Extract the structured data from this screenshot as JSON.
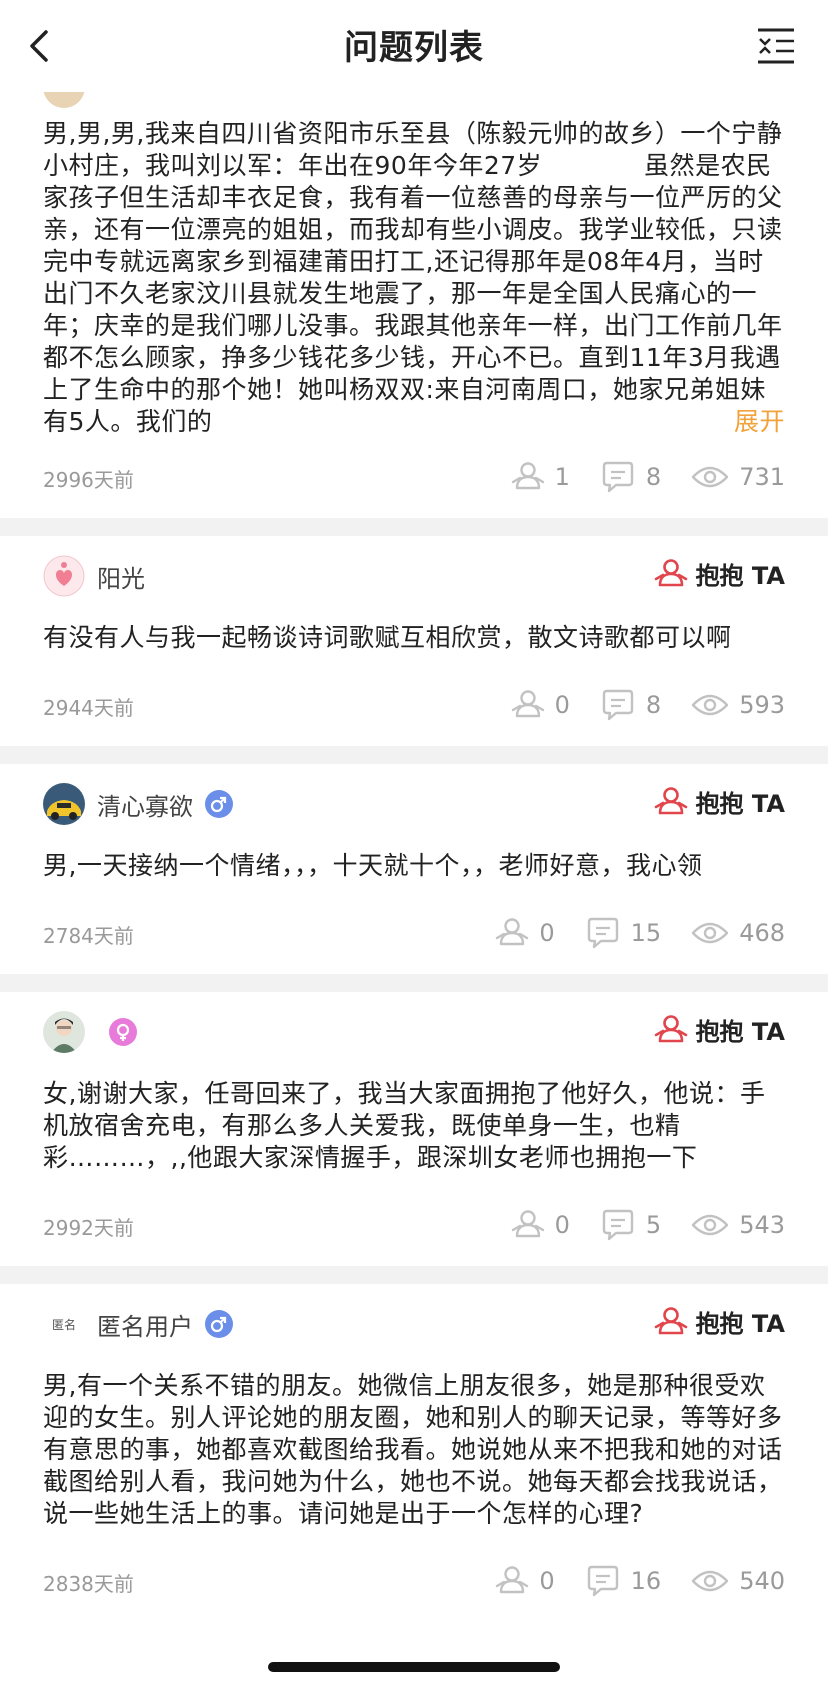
{
  "header": {
    "title": "问题列表"
  },
  "hug_label": "抱抱 TA",
  "expand_label": "展开",
  "posts": [
    {
      "body": "男,男,男,我来自四川省资阳市乐至县（陈毅元帅的故乡）一个宁静小村庄，我叫刘以军：年出在90年今年27岁　　　　虽然是农民家孩子但生活却丰衣足食，我有着一位慈善的母亲与一位严厉的父亲，还有一位漂亮的姐姐，而我却有些小调皮。我学业较低，只读完中专就远离家乡到福建莆田打工,还记得那年是08年4月，当时出门不久老家汶川县就发生地震了，那一年是全国人民痛心的一年；庆幸的是我们哪儿没事。我跟其他亲年一样，出门工作前几年都不怎么顾家，挣多少钱花多少钱，开心不已。直到11年3月我遇上了生命中的那个她！她叫杨双双:来自河南周口，她家兄弟姐妹有5人。我们的",
      "time": "2996天前",
      "hugs": "1",
      "comments": "8",
      "views": "731"
    },
    {
      "username": "阳光",
      "body": "有没有人与我一起畅谈诗词歌赋互相欣赏，散文诗歌都可以啊",
      "time": "2944天前",
      "hugs": "0",
      "comments": "8",
      "views": "593"
    },
    {
      "username": "清心寡欲",
      "body": "男,一天接纳一个情绪，，，十天就十个，，老师好意，我心领",
      "time": "2784天前",
      "hugs": "0",
      "comments": "15",
      "views": "468"
    },
    {
      "username": "",
      "body": "女,谢谢大家，任哥回来了，我当大家面拥抱了他好久，他说：手机放宿舍充电，有那么多人关爱我，既使单身一生，也精彩………，,,他跟大家深情握手，跟深圳女老师也拥抱一下",
      "time": "2992天前",
      "hugs": "0",
      "comments": "5",
      "views": "543"
    },
    {
      "username": "匿名用户",
      "avatar_text": "匿名",
      "body": "男,有一个关系不错的朋友。她微信上朋友很多，她是那种很受欢迎的女生。别人评论她的朋友圈，她和别人的聊天记录，等等好多有意思的事，她都喜欢截图给我看。她说她从来不把我和她的对话截图给别人看，我问她为什么，她也不说。她每天都会找我说话，说一些她生活上的事。请问她是出于一个怎样的心理?",
      "time": "2838天前",
      "hugs": "0",
      "comments": "16",
      "views": "540"
    }
  ],
  "colors": {
    "accent_hug": "#e0464c",
    "expand": "#f2a23a",
    "male_badge": "#6b8fe8",
    "female_badge": "#e87ad9",
    "meta_grey": "#9a9a9a"
  },
  "icons": [
    "back-chevron-icon",
    "filter-list-icon",
    "hug-icon",
    "comment-icon",
    "eye-icon",
    "male-icon",
    "female-icon"
  ]
}
